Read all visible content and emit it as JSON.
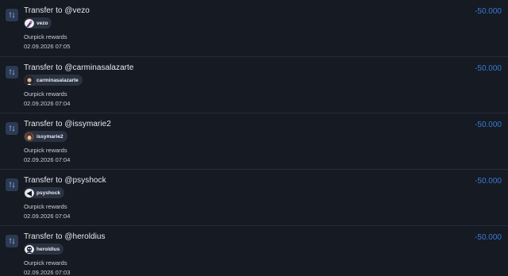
{
  "transactions": [
    {
      "title": "Transfer to @vezo",
      "user": "vezo",
      "avatar_icon": "avatar-vezo",
      "note": "Ourpick rewards",
      "time": "02.09.2026 07:05",
      "amount": "-50.000"
    },
    {
      "title": "Transfer to @carminasalazarte",
      "user": "carminasalazarte",
      "avatar_icon": "avatar-carminasalazarte",
      "note": "Ourpick rewards",
      "time": "02.09.2026 07:04",
      "amount": "-50.000"
    },
    {
      "title": "Transfer to @issymarie2",
      "user": "issymarie2",
      "avatar_icon": "avatar-issymarie2",
      "note": "Ourpick rewards",
      "time": "02.09.2026 07:04",
      "amount": "-50.000"
    },
    {
      "title": "Transfer to @psyshock",
      "user": "psyshock",
      "avatar_icon": "avatar-psyshock",
      "note": "Ourpick rewards",
      "time": "02.09.2026 07:04",
      "amount": "-50.000"
    },
    {
      "title": "Transfer to @heroldius",
      "user": "heroldius",
      "avatar_icon": "avatar-heroldius",
      "note": "Ourpick rewards",
      "time": "02.09.2026 07:03",
      "amount": "-50.000"
    }
  ],
  "colors": {
    "background": "#151a23",
    "amount_negative": "#3b7ad6",
    "divider": "#262d3b",
    "chip_background": "#2a3242",
    "type_icon_background": "#2c3a52"
  }
}
